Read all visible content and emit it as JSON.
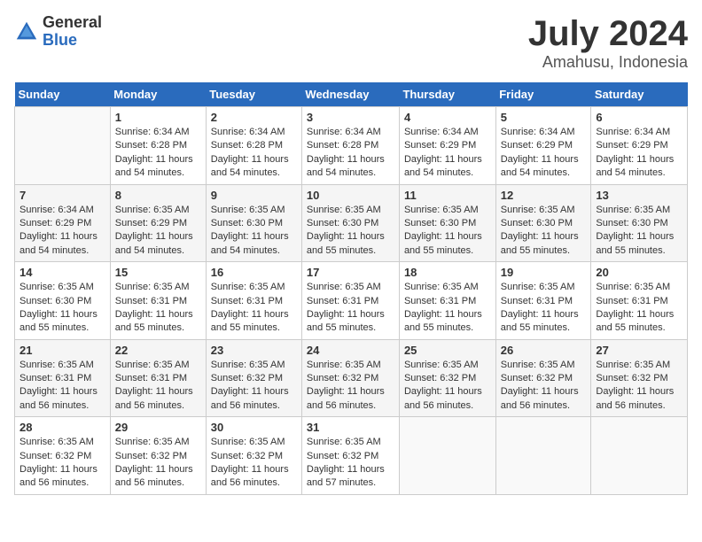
{
  "header": {
    "logo_general": "General",
    "logo_blue": "Blue",
    "month": "July 2024",
    "location": "Amahusu, Indonesia"
  },
  "days_of_week": [
    "Sunday",
    "Monday",
    "Tuesday",
    "Wednesday",
    "Thursday",
    "Friday",
    "Saturday"
  ],
  "weeks": [
    [
      {
        "day": "",
        "info": ""
      },
      {
        "day": "1",
        "info": "Sunrise: 6:34 AM\nSunset: 6:28 PM\nDaylight: 11 hours and 54 minutes."
      },
      {
        "day": "2",
        "info": "Sunrise: 6:34 AM\nSunset: 6:28 PM\nDaylight: 11 hours and 54 minutes."
      },
      {
        "day": "3",
        "info": "Sunrise: 6:34 AM\nSunset: 6:28 PM\nDaylight: 11 hours and 54 minutes."
      },
      {
        "day": "4",
        "info": "Sunrise: 6:34 AM\nSunset: 6:29 PM\nDaylight: 11 hours and 54 minutes."
      },
      {
        "day": "5",
        "info": "Sunrise: 6:34 AM\nSunset: 6:29 PM\nDaylight: 11 hours and 54 minutes."
      },
      {
        "day": "6",
        "info": "Sunrise: 6:34 AM\nSunset: 6:29 PM\nDaylight: 11 hours and 54 minutes."
      }
    ],
    [
      {
        "day": "7",
        "info": "Sunrise: 6:34 AM\nSunset: 6:29 PM\nDaylight: 11 hours and 54 minutes."
      },
      {
        "day": "8",
        "info": "Sunrise: 6:35 AM\nSunset: 6:29 PM\nDaylight: 11 hours and 54 minutes."
      },
      {
        "day": "9",
        "info": "Sunrise: 6:35 AM\nSunset: 6:30 PM\nDaylight: 11 hours and 54 minutes."
      },
      {
        "day": "10",
        "info": "Sunrise: 6:35 AM\nSunset: 6:30 PM\nDaylight: 11 hours and 55 minutes."
      },
      {
        "day": "11",
        "info": "Sunrise: 6:35 AM\nSunset: 6:30 PM\nDaylight: 11 hours and 55 minutes."
      },
      {
        "day": "12",
        "info": "Sunrise: 6:35 AM\nSunset: 6:30 PM\nDaylight: 11 hours and 55 minutes."
      },
      {
        "day": "13",
        "info": "Sunrise: 6:35 AM\nSunset: 6:30 PM\nDaylight: 11 hours and 55 minutes."
      }
    ],
    [
      {
        "day": "14",
        "info": "Sunrise: 6:35 AM\nSunset: 6:30 PM\nDaylight: 11 hours and 55 minutes."
      },
      {
        "day": "15",
        "info": "Sunrise: 6:35 AM\nSunset: 6:31 PM\nDaylight: 11 hours and 55 minutes."
      },
      {
        "day": "16",
        "info": "Sunrise: 6:35 AM\nSunset: 6:31 PM\nDaylight: 11 hours and 55 minutes."
      },
      {
        "day": "17",
        "info": "Sunrise: 6:35 AM\nSunset: 6:31 PM\nDaylight: 11 hours and 55 minutes."
      },
      {
        "day": "18",
        "info": "Sunrise: 6:35 AM\nSunset: 6:31 PM\nDaylight: 11 hours and 55 minutes."
      },
      {
        "day": "19",
        "info": "Sunrise: 6:35 AM\nSunset: 6:31 PM\nDaylight: 11 hours and 55 minutes."
      },
      {
        "day": "20",
        "info": "Sunrise: 6:35 AM\nSunset: 6:31 PM\nDaylight: 11 hours and 55 minutes."
      }
    ],
    [
      {
        "day": "21",
        "info": "Sunrise: 6:35 AM\nSunset: 6:31 PM\nDaylight: 11 hours and 56 minutes."
      },
      {
        "day": "22",
        "info": "Sunrise: 6:35 AM\nSunset: 6:31 PM\nDaylight: 11 hours and 56 minutes."
      },
      {
        "day": "23",
        "info": "Sunrise: 6:35 AM\nSunset: 6:32 PM\nDaylight: 11 hours and 56 minutes."
      },
      {
        "day": "24",
        "info": "Sunrise: 6:35 AM\nSunset: 6:32 PM\nDaylight: 11 hours and 56 minutes."
      },
      {
        "day": "25",
        "info": "Sunrise: 6:35 AM\nSunset: 6:32 PM\nDaylight: 11 hours and 56 minutes."
      },
      {
        "day": "26",
        "info": "Sunrise: 6:35 AM\nSunset: 6:32 PM\nDaylight: 11 hours and 56 minutes."
      },
      {
        "day": "27",
        "info": "Sunrise: 6:35 AM\nSunset: 6:32 PM\nDaylight: 11 hours and 56 minutes."
      }
    ],
    [
      {
        "day": "28",
        "info": "Sunrise: 6:35 AM\nSunset: 6:32 PM\nDaylight: 11 hours and 56 minutes."
      },
      {
        "day": "29",
        "info": "Sunrise: 6:35 AM\nSunset: 6:32 PM\nDaylight: 11 hours and 56 minutes."
      },
      {
        "day": "30",
        "info": "Sunrise: 6:35 AM\nSunset: 6:32 PM\nDaylight: 11 hours and 56 minutes."
      },
      {
        "day": "31",
        "info": "Sunrise: 6:35 AM\nSunset: 6:32 PM\nDaylight: 11 hours and 57 minutes."
      },
      {
        "day": "",
        "info": ""
      },
      {
        "day": "",
        "info": ""
      },
      {
        "day": "",
        "info": ""
      }
    ]
  ]
}
